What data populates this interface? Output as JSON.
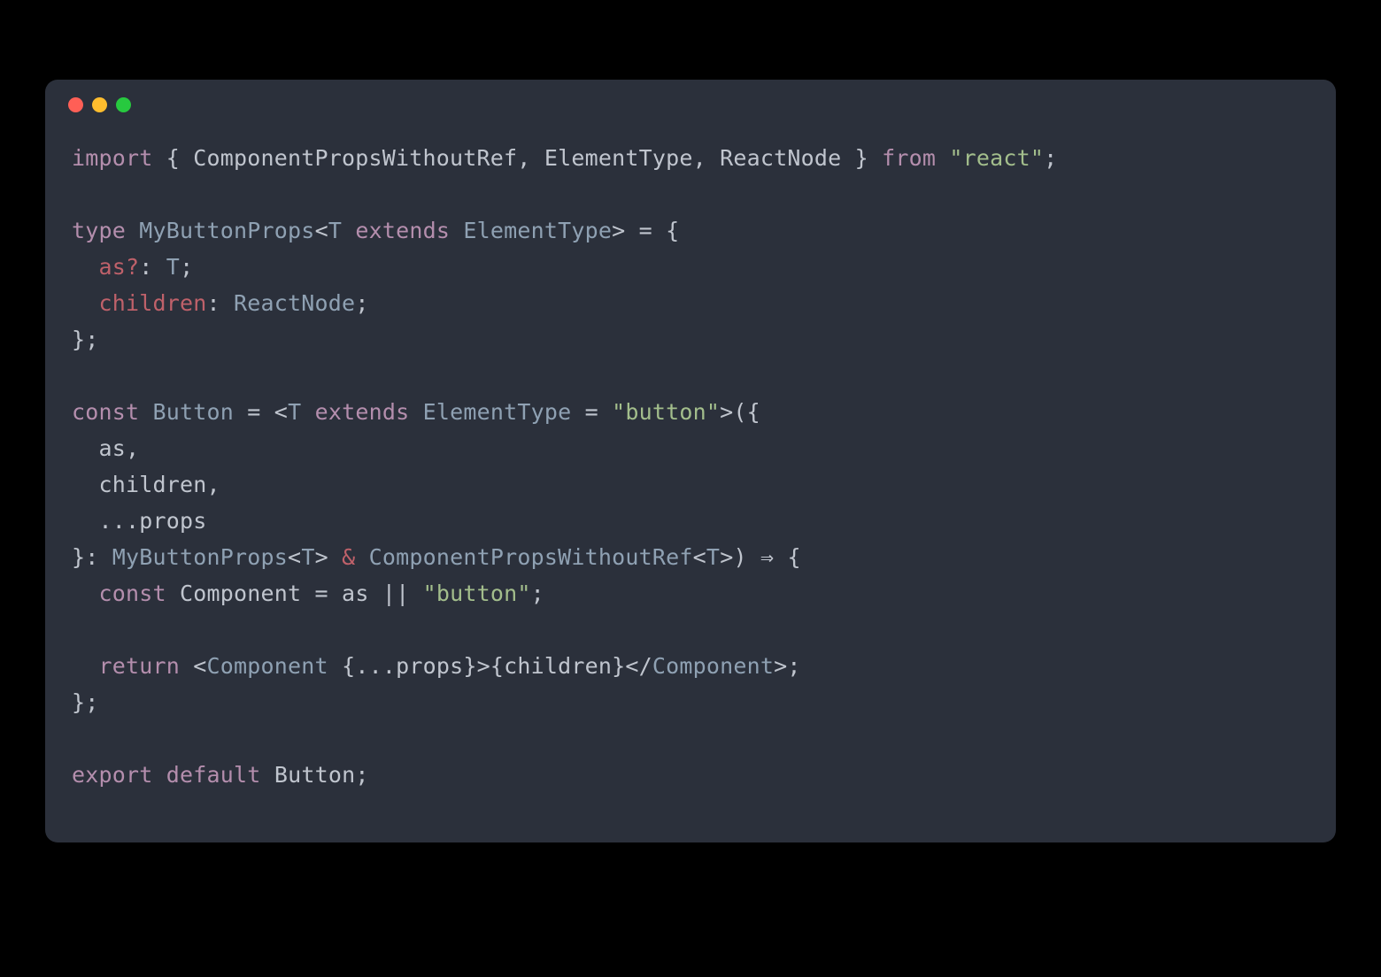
{
  "colors": {
    "background": "#000000",
    "window": "#2b303b",
    "close": "#ff5f56",
    "minimize": "#ffbd2e",
    "zoom": "#27c93f",
    "keyword": "#b48ead",
    "type": "#8fa1b3",
    "string": "#a3be8c",
    "prop": "#bf616a",
    "fg": "#c0c5ce",
    "dim": "#65737e"
  },
  "traffic_lights": [
    "close",
    "minimize",
    "zoom"
  ],
  "code": {
    "lines": [
      [
        {
          "c": "kw",
          "t": "import"
        },
        {
          "c": "punc",
          "t": " { "
        },
        {
          "c": "id",
          "t": "ComponentPropsWithoutRef, ElementType, ReactNode"
        },
        {
          "c": "punc",
          "t": " } "
        },
        {
          "c": "kw",
          "t": "from"
        },
        {
          "c": "punc",
          "t": " "
        },
        {
          "c": "str",
          "t": "\"react\""
        },
        {
          "c": "punc",
          "t": ";"
        }
      ],
      [],
      [
        {
          "c": "kw",
          "t": "type"
        },
        {
          "c": "punc",
          "t": " "
        },
        {
          "c": "type",
          "t": "MyButtonProps"
        },
        {
          "c": "punc",
          "t": "<"
        },
        {
          "c": "type",
          "t": "T"
        },
        {
          "c": "punc",
          "t": " "
        },
        {
          "c": "kw",
          "t": "extends"
        },
        {
          "c": "punc",
          "t": " "
        },
        {
          "c": "type",
          "t": "ElementType"
        },
        {
          "c": "punc",
          "t": "> = {"
        }
      ],
      [
        {
          "c": "punc",
          "t": "  "
        },
        {
          "c": "prop",
          "t": "as?"
        },
        {
          "c": "punc",
          "t": ": "
        },
        {
          "c": "type",
          "t": "T"
        },
        {
          "c": "punc",
          "t": ";"
        }
      ],
      [
        {
          "c": "punc",
          "t": "  "
        },
        {
          "c": "prop",
          "t": "children"
        },
        {
          "c": "punc",
          "t": ": "
        },
        {
          "c": "type",
          "t": "ReactNode"
        },
        {
          "c": "punc",
          "t": ";"
        }
      ],
      [
        {
          "c": "punc",
          "t": "};"
        }
      ],
      [],
      [
        {
          "c": "kw",
          "t": "const"
        },
        {
          "c": "punc",
          "t": " "
        },
        {
          "c": "type",
          "t": "Button"
        },
        {
          "c": "punc",
          "t": " = <"
        },
        {
          "c": "type",
          "t": "T"
        },
        {
          "c": "punc",
          "t": " "
        },
        {
          "c": "kw",
          "t": "extends"
        },
        {
          "c": "punc",
          "t": " "
        },
        {
          "c": "type",
          "t": "ElementType"
        },
        {
          "c": "punc",
          "t": " = "
        },
        {
          "c": "str",
          "t": "\"button\""
        },
        {
          "c": "punc",
          "t": ">({"
        }
      ],
      [
        {
          "c": "punc",
          "t": "  "
        },
        {
          "c": "id",
          "t": "as,"
        }
      ],
      [
        {
          "c": "punc",
          "t": "  "
        },
        {
          "c": "id",
          "t": "children,"
        }
      ],
      [
        {
          "c": "punc",
          "t": "  "
        },
        {
          "c": "punc",
          "t": "..."
        },
        {
          "c": "id",
          "t": "props"
        }
      ],
      [
        {
          "c": "punc",
          "t": "}: "
        },
        {
          "c": "type",
          "t": "MyButtonProps"
        },
        {
          "c": "punc",
          "t": "<"
        },
        {
          "c": "type",
          "t": "T"
        },
        {
          "c": "punc",
          "t": "> "
        },
        {
          "c": "amp",
          "t": "&"
        },
        {
          "c": "punc",
          "t": " "
        },
        {
          "c": "type",
          "t": "ComponentPropsWithoutRef"
        },
        {
          "c": "punc",
          "t": "<"
        },
        {
          "c": "type",
          "t": "T"
        },
        {
          "c": "punc",
          "t": ">) "
        },
        {
          "c": "punc",
          "t": "⇒"
        },
        {
          "c": "punc",
          "t": " {"
        }
      ],
      [
        {
          "c": "punc",
          "t": "  "
        },
        {
          "c": "kw",
          "t": "const"
        },
        {
          "c": "punc",
          "t": " "
        },
        {
          "c": "id",
          "t": "Component = as "
        },
        {
          "c": "punc",
          "t": "||"
        },
        {
          "c": "punc",
          "t": " "
        },
        {
          "c": "str",
          "t": "\"button\""
        },
        {
          "c": "punc",
          "t": ";"
        }
      ],
      [],
      [
        {
          "c": "punc",
          "t": "  "
        },
        {
          "c": "kw",
          "t": "return"
        },
        {
          "c": "punc",
          "t": " <"
        },
        {
          "c": "type",
          "t": "Component"
        },
        {
          "c": "punc",
          "t": " {"
        },
        {
          "c": "punc",
          "t": "..."
        },
        {
          "c": "id",
          "t": "props"
        },
        {
          "c": "punc",
          "t": "}>{"
        },
        {
          "c": "id",
          "t": "children"
        },
        {
          "c": "punc",
          "t": "}</"
        },
        {
          "c": "type",
          "t": "Component"
        },
        {
          "c": "punc",
          "t": ">;"
        }
      ],
      [
        {
          "c": "punc",
          "t": "};"
        }
      ],
      [],
      [
        {
          "c": "kw",
          "t": "export"
        },
        {
          "c": "punc",
          "t": " "
        },
        {
          "c": "kw",
          "t": "default"
        },
        {
          "c": "punc",
          "t": " "
        },
        {
          "c": "id",
          "t": "Button;"
        }
      ]
    ]
  }
}
